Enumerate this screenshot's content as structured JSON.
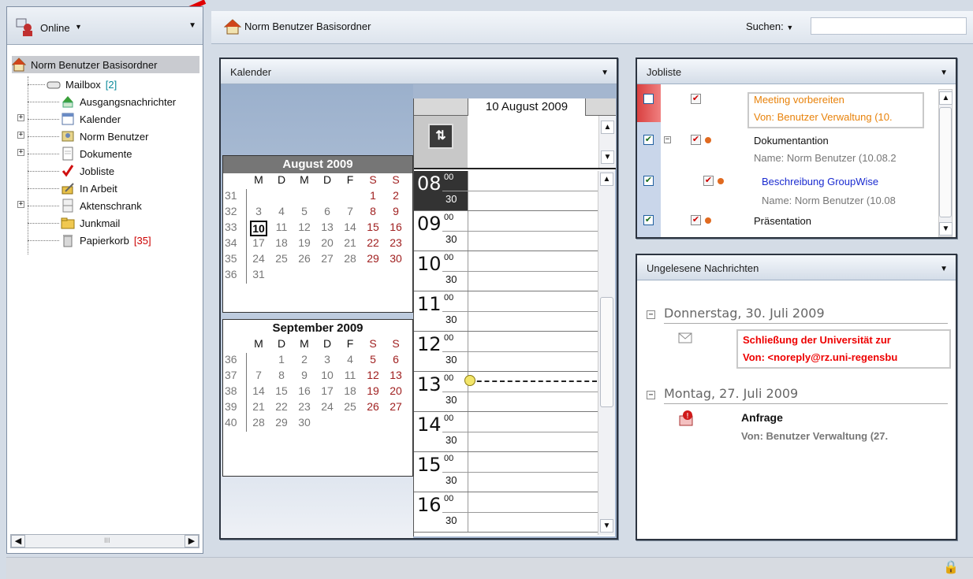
{
  "left_panel": {
    "status_label": "Online",
    "status_icon": "user-online-icon",
    "tree": [
      {
        "label": "Norm Benutzer Basisordner",
        "icon": "home-icon"
      },
      {
        "label": "Mailbox",
        "count": "[2]",
        "icon": "mailbox-icon"
      },
      {
        "label": "Ausgangsnachrichter",
        "icon": "outbox-icon"
      },
      {
        "label": "Kalender",
        "icon": "calendar-icon"
      },
      {
        "label": "Norm Benutzer",
        "icon": "user-folder-icon"
      },
      {
        "label": "Dokumente",
        "icon": "documents-icon"
      },
      {
        "label": "Jobliste",
        "icon": "checkmark-icon"
      },
      {
        "label": "In Arbeit",
        "icon": "in-progress-icon"
      },
      {
        "label": "Aktenschrank",
        "icon": "cabinet-icon"
      },
      {
        "label": "Junkmail",
        "icon": "junk-folder-icon"
      },
      {
        "label": "Papierkorb",
        "count": "[35]",
        "icon": "trash-icon"
      }
    ],
    "scroll_grip": "III"
  },
  "header": {
    "title": "Norm Benutzer Basisordner",
    "search_label": "Suchen:",
    "search_value": ""
  },
  "calendar": {
    "title": "Kalender",
    "months": [
      {
        "name": "August 2009",
        "weekdays": [
          "M",
          "D",
          "M",
          "D",
          "F",
          "S",
          "S"
        ],
        "weeks": [
          {
            "wk": "31",
            "days": [
              "",
              "",
              "",
              "",
              "",
              "1",
              "2"
            ]
          },
          {
            "wk": "32",
            "days": [
              "3",
              "4",
              "5",
              "6",
              "7",
              "8",
              "9"
            ]
          },
          {
            "wk": "33",
            "days": [
              "10",
              "11",
              "12",
              "13",
              "14",
              "15",
              "16"
            ]
          },
          {
            "wk": "34",
            "days": [
              "17",
              "18",
              "19",
              "20",
              "21",
              "22",
              "23"
            ]
          },
          {
            "wk": "35",
            "days": [
              "24",
              "25",
              "26",
              "27",
              "28",
              "29",
              "30"
            ]
          },
          {
            "wk": "36",
            "days": [
              "31",
              "",
              "",
              "",
              "",
              "",
              ""
            ]
          }
        ],
        "today": "10"
      },
      {
        "name": "September 2009",
        "weekdays": [
          "M",
          "D",
          "M",
          "D",
          "F",
          "S",
          "S"
        ],
        "weeks": [
          {
            "wk": "36",
            "days": [
              "",
              "1",
              "2",
              "3",
              "4",
              "5",
              "6"
            ]
          },
          {
            "wk": "37",
            "days": [
              "7",
              "8",
              "9",
              "10",
              "11",
              "12",
              "13"
            ]
          },
          {
            "wk": "38",
            "days": [
              "14",
              "15",
              "16",
              "17",
              "18",
              "19",
              "20"
            ]
          },
          {
            "wk": "39",
            "days": [
              "21",
              "22",
              "23",
              "24",
              "25",
              "26",
              "27"
            ]
          },
          {
            "wk": "40",
            "days": [
              "28",
              "29",
              "30",
              "",
              "",
              "",
              ""
            ]
          }
        ]
      }
    ],
    "day_view": {
      "date": "10 August 2009",
      "hours": [
        "08",
        "09",
        "10",
        "11",
        "12",
        "13",
        "14",
        "15",
        "16"
      ],
      "current_hour": "08",
      "min_00": "00",
      "min_30": "30"
    }
  },
  "jobliste": {
    "title": "Jobliste",
    "items": [
      {
        "title": "Meeting vorbereiten",
        "sub": "Von: Benutzer Verwaltung (10.",
        "color": "#e8820a"
      },
      {
        "title": "Dokumentantion",
        "sub": "Name: Norm Benutzer (10.08.2"
      },
      {
        "title": "Beschreibung GroupWise",
        "sub": "Name: Norm Benutzer (10.08"
      },
      {
        "title": "Präsentation"
      }
    ]
  },
  "unread": {
    "title": "Ungelesene Nachrichten",
    "groups": [
      {
        "date": "Donnerstag, 30. Juli 2009",
        "subject": "Schließung der Universität zur",
        "from": "Von: <noreply@rz.uni-regensbu"
      },
      {
        "date": "Montag, 27. Juli 2009",
        "subject": "Anfrage",
        "from": "Von: Benutzer Verwaltung (27."
      }
    ]
  }
}
